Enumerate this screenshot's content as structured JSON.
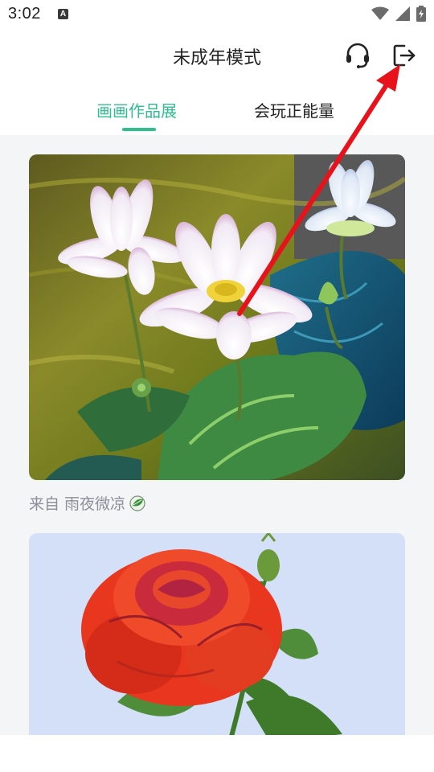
{
  "status_bar": {
    "time": "3:02",
    "notification_letter": "A"
  },
  "header": {
    "title": "未成年模式",
    "support_icon": "headset-icon",
    "exit_icon": "logout-icon"
  },
  "tabs": [
    {
      "label": "画画作品展",
      "active": true
    },
    {
      "label": "会玩正能量",
      "active": false
    }
  ],
  "colors": {
    "accent": "#2fbf8f",
    "arrow": "#e8121b"
  },
  "feed": {
    "items": [
      {
        "artwork": "lotus-painting",
        "caption": "来自 雨夜微凉",
        "caption_icon": "leaf-badge-icon"
      },
      {
        "artwork": "rose-painting",
        "caption": "",
        "caption_icon": ""
      }
    ]
  }
}
